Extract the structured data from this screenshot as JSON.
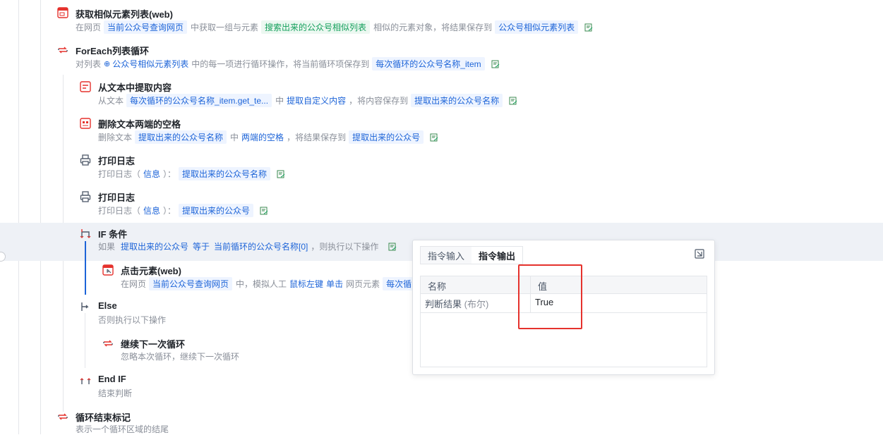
{
  "steps": {
    "get_similar": {
      "title": "获取相似元素列表(web)",
      "d1": "在网页",
      "c1": "当前公众号查询网页",
      "d2": "中获取一组与元素",
      "c2": "搜索出来的公众号相似列表",
      "d3": "相似的元素对象，将结果保存到",
      "c3": "公众号相似元素列表"
    },
    "foreach": {
      "title": "ForEach列表循环",
      "d1": "对列表",
      "l1": "公众号相似元素列表",
      "d2": "中的每一项进行循环操作，将当前循环项保存到",
      "c1": "每次循环的公众号名称_item"
    },
    "extract": {
      "title": "从文本中提取内容",
      "d1": "从文本",
      "c1": "每次循环的公众号名称_item.get_te...",
      "d2": "中",
      "l1": "提取自定义内容",
      "d3": "，将内容保存到",
      "c2": "提取出来的公众号名称"
    },
    "trim": {
      "title": "删除文本两端的空格",
      "d1": "删除文本",
      "c1": "提取出来的公众号名称",
      "d2": "中",
      "l1": "两端的空格",
      "d3": "，将结果保存到",
      "c2": "提取出来的公众号"
    },
    "log1": {
      "title": "打印日志",
      "d1": "打印日志（",
      "l1": "信息",
      "d2": "）：",
      "c1": "提取出来的公众号名称"
    },
    "log2": {
      "title": "打印日志",
      "d1": "打印日志（",
      "l1": "信息",
      "d2": "）：",
      "c1": "提取出来的公众号"
    },
    "if": {
      "title": "IF 条件",
      "d1": "如果",
      "l1": "提取出来的公众号",
      "l2": "等于",
      "l3": "当前循环的公众号名称[0]",
      "d2": "，则执行以下操作"
    },
    "click": {
      "title": "点击元素(web)",
      "d1": "在网页",
      "c1": "当前公众号查询网页",
      "d2": "中，模拟人工",
      "l1": "鼠标左键",
      "l2": "单击",
      "d3": "网页元素",
      "c2": "每次循"
    },
    "else": {
      "title": "Else",
      "desc": "否则执行以下操作"
    },
    "continue": {
      "title": "继续下一次循环",
      "desc": "忽略本次循环，继续下一次循环"
    },
    "endif": {
      "title": "End IF",
      "desc": "结束判断"
    },
    "loopend": {
      "title": "循环结束标记",
      "desc": "表示一个循环区域的结尾"
    }
  },
  "popup": {
    "tab_input": "指令输入",
    "tab_output": "指令输出",
    "col_name": "名称",
    "col_value": "值",
    "row_name": "判断结果",
    "row_type": "(布尔)",
    "row_value": "True"
  },
  "colors": {
    "accent": "#1d64d8",
    "green": "#15a05c",
    "highlight": "#e5322d"
  }
}
